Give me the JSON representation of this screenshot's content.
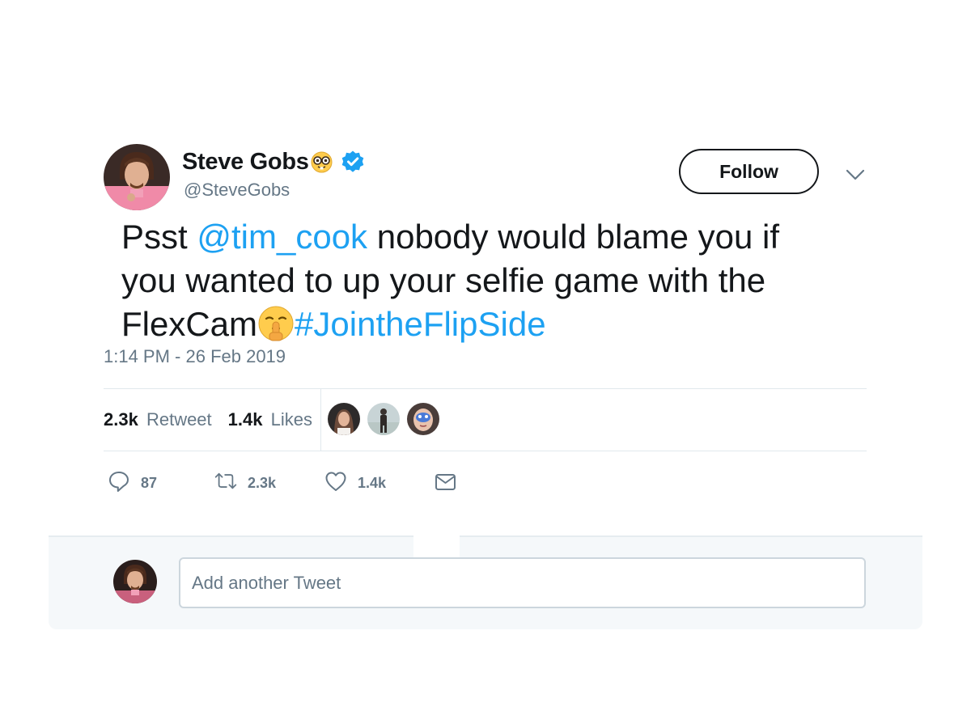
{
  "author": {
    "display_name": "Steve Gobs",
    "handle": "@SteveGobs",
    "name_emoji": "nerd-face-emoji",
    "verified": true
  },
  "header": {
    "follow_label": "Follow",
    "menu_icon": "chevron-down-icon"
  },
  "tweet": {
    "text_1": "Psst ",
    "mention": "@tim_cook",
    "text_2": " nobody would blame you if you wanted to up your selfie game with the FlexCam",
    "inline_emoji": "shushing-face-emoji",
    "hashtag": "#JointheFlipSide",
    "timestamp": "1:14 PM - 26 Feb 2019",
    "link_color": "#1da1f2"
  },
  "stats": {
    "retweet_count": "2.3k",
    "retweet_label": "Retweet",
    "like_count": "1.4k",
    "like_label": "Likes"
  },
  "likers": [
    "liker-avatar-woman",
    "liker-avatar-man-standing",
    "liker-avatar-painted-face"
  ],
  "actions": {
    "reply_count": "87",
    "retweet_count": "2.3k",
    "like_count": "1.4k",
    "icons": [
      "reply-icon",
      "retweet-icon",
      "heart-icon",
      "envelope-icon"
    ]
  },
  "reply": {
    "placeholder": "Add another Tweet"
  },
  "colors": {
    "text": "#14171a",
    "muted": "#657786",
    "accent": "#1da1f2",
    "verified": "#1da1f2",
    "divider": "#e1e8ed",
    "reply_bg": "#f5f8fa"
  }
}
